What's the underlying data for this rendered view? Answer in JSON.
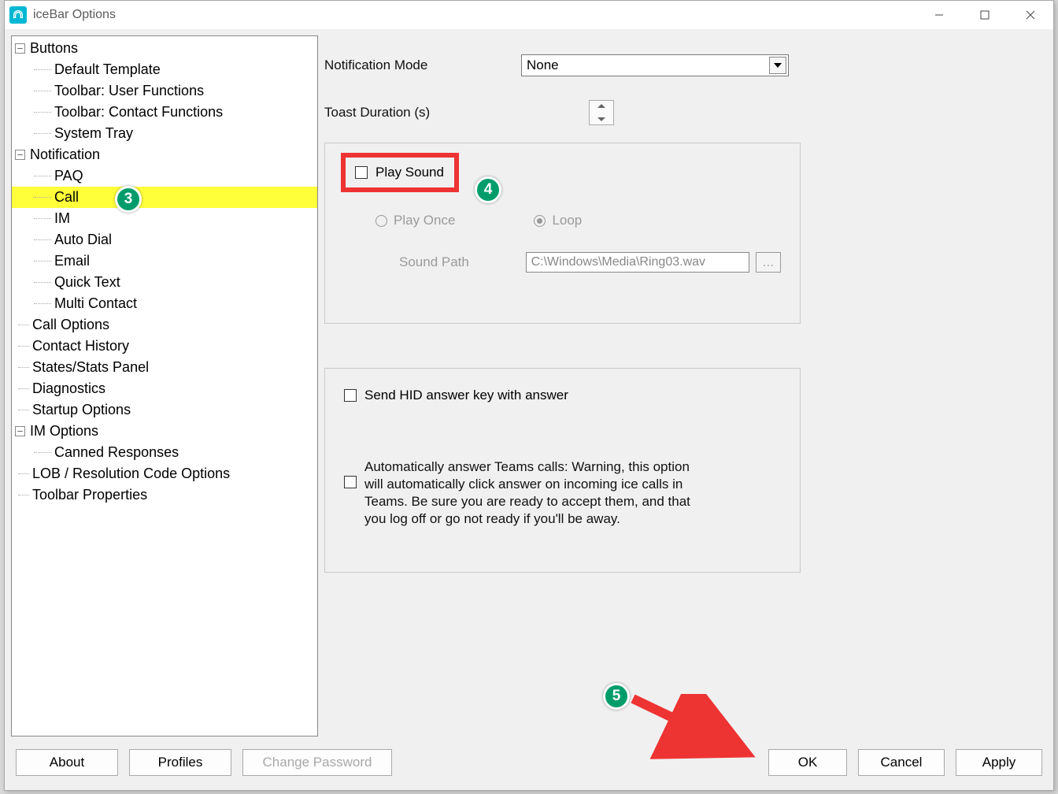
{
  "title": "iceBar Options",
  "tree": {
    "buttons": {
      "label": "Buttons",
      "children": [
        "Default Template",
        "Toolbar: User Functions",
        "Toolbar: Contact Functions",
        "System Tray"
      ]
    },
    "notification": {
      "label": "Notification",
      "children": [
        "PAQ",
        "Call",
        "IM",
        "Auto Dial",
        "Email",
        "Quick Text",
        "Multi Contact"
      ],
      "selected_index": 1
    },
    "standalone1": [
      "Call Options",
      "Contact History",
      "States/Stats Panel",
      "Diagnostics",
      "Startup Options"
    ],
    "im_options": {
      "label": "IM Options",
      "children": [
        "Canned Responses"
      ]
    },
    "standalone2": [
      "LOB / Resolution Code Options",
      "Toolbar Properties"
    ]
  },
  "panel": {
    "notification_mode_label": "Notification Mode",
    "notification_mode_value": "None",
    "toast_duration_label": "Toast Duration (s)",
    "play_sound_label": "Play Sound",
    "play_once_label": "Play Once",
    "loop_label": "Loop",
    "sound_path_label": "Sound Path",
    "sound_path_value": "C:\\Windows\\Media\\Ring03.wav",
    "browse_label": "...",
    "send_hid_label": "Send HID answer key with answer",
    "auto_answer_label": "Automatically answer Teams calls: Warning, this option will automatically click answer on incoming ice calls in Teams.  Be sure you are ready to accept them, and that you log off or go not ready if you'll be away."
  },
  "footer": {
    "about": "About",
    "profiles": "Profiles",
    "change_password": "Change Password",
    "ok": "OK",
    "cancel": "Cancel",
    "apply": "Apply"
  },
  "annotations": {
    "step3": "3",
    "step4": "4",
    "step5": "5"
  }
}
